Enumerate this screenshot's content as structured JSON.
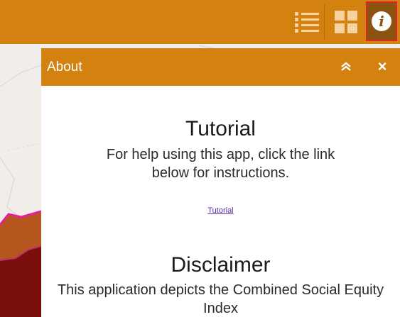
{
  "toolbar": {
    "tools": [
      {
        "icon": "legend-list-icon"
      },
      {
        "icon": "basemap-grid-icon"
      },
      {
        "icon": "info-icon",
        "glyph": "i",
        "selected": true
      }
    ],
    "colors": {
      "bar": "#d4820f",
      "active": "#8a5410",
      "highlight": "#e0242a"
    }
  },
  "panel": {
    "title": "About",
    "collapse_icon": "double-chevron-up-icon",
    "close_glyph": "×",
    "sections": {
      "tutorial_heading": "Tutorial",
      "tutorial_text": "For help using this app, click the link below for instructions.",
      "tutorial_link": "Tutorial",
      "disclaimer_heading": "Disclaimer",
      "disclaimer_text": "This application depicts the Combined Social Equity Index"
    }
  }
}
